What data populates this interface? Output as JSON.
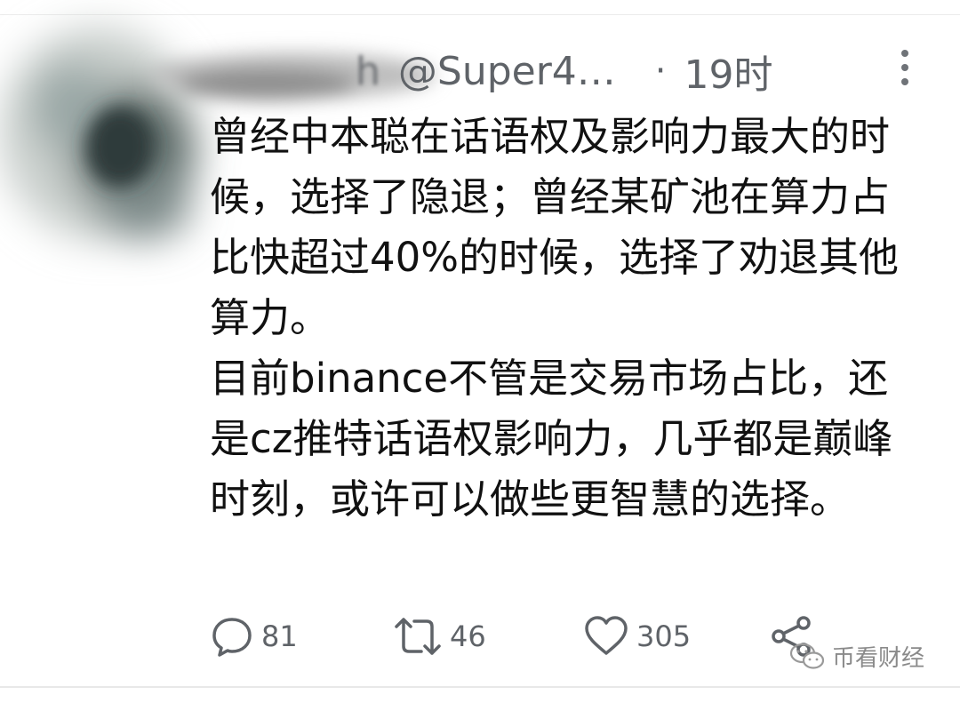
{
  "tweet": {
    "author_name": "h",
    "handle": "@Super4…",
    "separator": "·",
    "time": "19时",
    "paragraphs": [
      "曾经中本聪在话语权及影响力最大的时候，选择了隐退；曾经某矿池在算力占比快超过40%的时候，选择了劝退其他算力。",
      "目前binance不管是交易市场占比，还是cz推特话语权影响力，几乎都是巅峰时刻，或许可以做些更智慧的选择。"
    ],
    "reply_count": "81",
    "retweet_count": "46",
    "like_count": "305"
  },
  "watermark": {
    "text": "币看财经"
  },
  "icons": {
    "reply": "reply-icon",
    "retweet": "retweet-icon",
    "like": "heart-icon",
    "share": "share-icon",
    "more": "more-vertical-icon",
    "watermark": "wechat-icon"
  },
  "colors": {
    "text": "#111111",
    "meta": "#5f6368",
    "background": "#ffffff"
  }
}
